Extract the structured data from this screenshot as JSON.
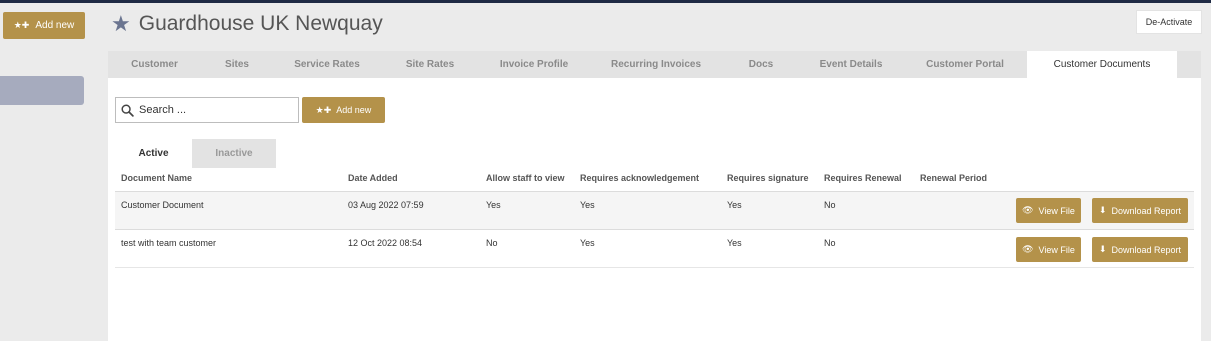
{
  "sidebar": {
    "add_new_label": "Add new"
  },
  "header": {
    "title": "Guardhouse UK Newquay",
    "deactivate_label": "De-Activate"
  },
  "tabs": [
    {
      "label": "Customer"
    },
    {
      "label": "Sites"
    },
    {
      "label": "Service Rates"
    },
    {
      "label": "Site Rates"
    },
    {
      "label": "Invoice Profile"
    },
    {
      "label": "Recurring Invoices"
    },
    {
      "label": "Docs"
    },
    {
      "label": "Event Details"
    },
    {
      "label": "Customer Portal"
    },
    {
      "label": "Customer Documents",
      "active": true
    }
  ],
  "toolbar": {
    "search_placeholder": "Search ...",
    "add_new_label": "Add new"
  },
  "subtabs": {
    "active": "Active",
    "inactive": "Inactive"
  },
  "table": {
    "columns": [
      "Document Name",
      "Date Added",
      "Allow staff to view",
      "Requires acknowledgement",
      "Requires signature",
      "Requires Renewal",
      "Renewal Period"
    ],
    "rows": [
      {
        "name": "Customer Document",
        "date": "03 Aug 2022 07:59",
        "staff": "Yes",
        "ack": "Yes",
        "sig": "Yes",
        "renewal": "No",
        "period": ""
      },
      {
        "name": "test with team customer",
        "date": "12 Oct 2022 08:54",
        "staff": "No",
        "ack": "Yes",
        "sig": "Yes",
        "renewal": "No",
        "period": ""
      }
    ],
    "view_label": "View File",
    "download_label": "Download Report"
  },
  "colors": {
    "accent": "#b4924a",
    "tab_bg": "#e3e3e3",
    "topbar": "#1f2a44",
    "sidebar_active": "#a6abbe"
  }
}
